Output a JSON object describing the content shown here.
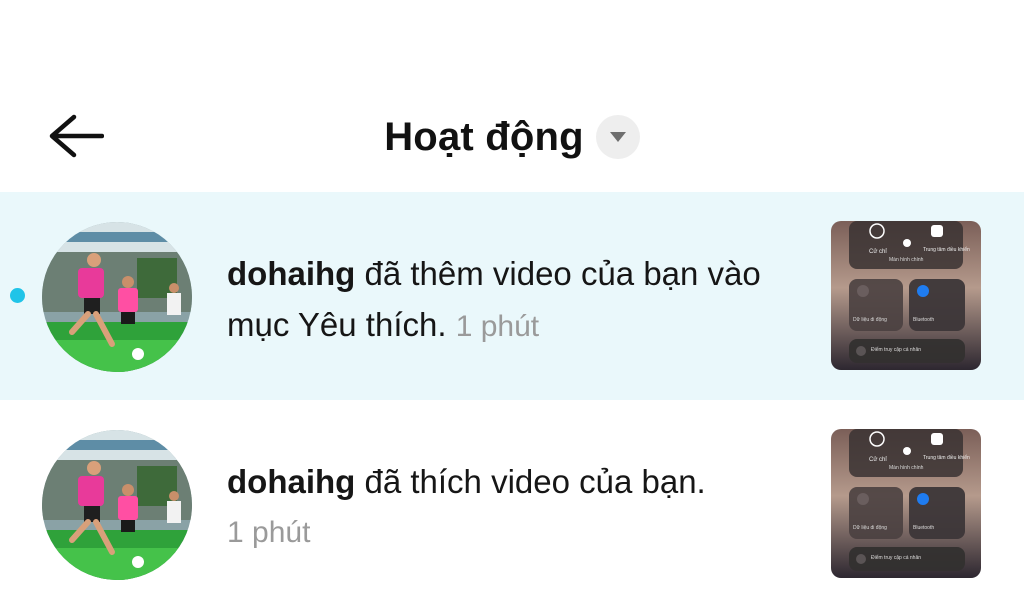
{
  "header": {
    "title": "Hoạt động",
    "back_icon": "arrow-left-icon",
    "dropdown_icon": "caret-down-icon"
  },
  "colors": {
    "unread_background": "#eaf8fb",
    "unread_dot": "#20c4e8",
    "timestamp": "#9a9a9a"
  },
  "notifications": [
    {
      "state": "unread",
      "username": "dohaihg",
      "text": " đã thêm video của bạn vào mục Yêu thích. ",
      "time": "1 phút",
      "thumb_labels": [
        "Cử chỉ",
        "Trung tâm điều khiển",
        "Màn hình chính",
        "Dữ liệu di động",
        "Bluetooth",
        "Điểm truy cập cá nhân"
      ]
    },
    {
      "state": "read",
      "username": "dohaihg",
      "text": " đã thích video của bạn.",
      "time": "1 phút",
      "thumb_labels": [
        "Cử chỉ",
        "Trung tâm điều khiển",
        "Màn hình chính",
        "Dữ liệu di động",
        "Bluetooth",
        "Điểm truy cập cá nhân"
      ]
    }
  ]
}
